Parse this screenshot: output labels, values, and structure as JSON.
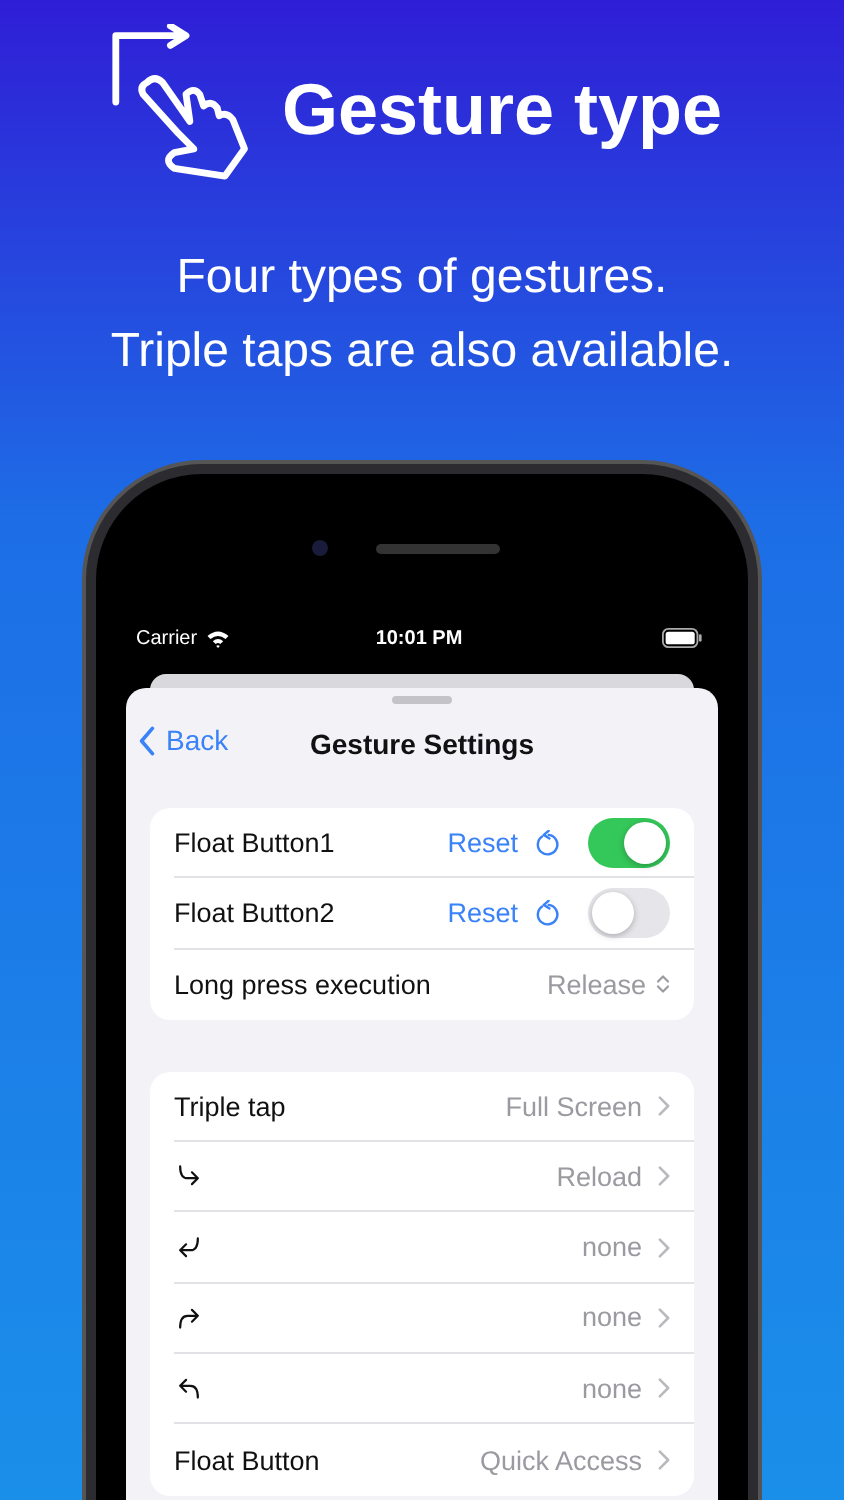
{
  "headline": {
    "title": "Gesture type",
    "subtitle": [
      "Four types of gestures.",
      "Triple taps are also available."
    ]
  },
  "status_bar": {
    "carrier": "Carrier",
    "time": "10:01 PM"
  },
  "nav": {
    "back": "Back",
    "title": "Gesture Settings"
  },
  "groups": [
    {
      "rows": [
        {
          "kind": "toggle",
          "label": "Float Button1",
          "action": "Reset",
          "on": true
        },
        {
          "kind": "toggle",
          "label": "Float Button2",
          "action": "Reset",
          "on": false
        },
        {
          "kind": "select",
          "label": "Long press execution",
          "value": "Release"
        }
      ]
    },
    {
      "rows": [
        {
          "kind": "link",
          "label": "Triple tap",
          "value": "Full Screen"
        },
        {
          "kind": "gesture",
          "value": "Reload"
        },
        {
          "kind": "gesture",
          "value": "none"
        },
        {
          "kind": "gesture",
          "value": "none"
        },
        {
          "kind": "gesture",
          "value": "none"
        },
        {
          "kind": "link",
          "label": "Float Button",
          "value": "Quick Access"
        }
      ]
    }
  ]
}
